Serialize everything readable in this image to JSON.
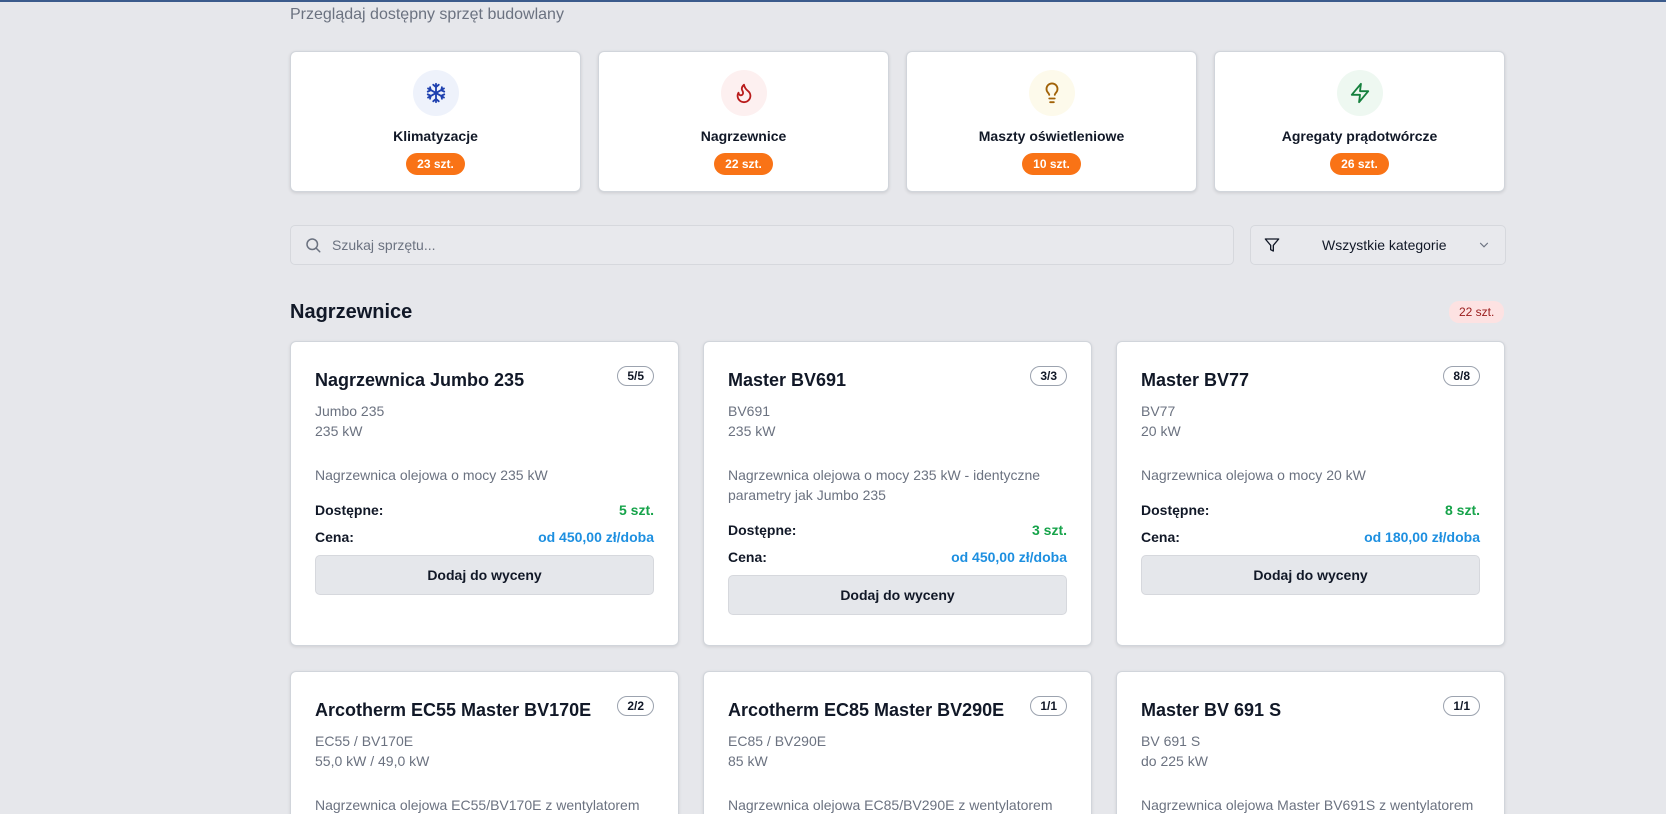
{
  "subtitle": "Przeglądaj dostępny sprzęt budowlany",
  "categories": [
    {
      "name": "Klimatyzacje",
      "count": "23 szt.",
      "icon": "snowflake-icon",
      "icon_bg": "#eef2fb",
      "icon_color": "#1e40af"
    },
    {
      "name": "Nagrzewnice",
      "count": "22 szt.",
      "icon": "flame-icon",
      "icon_bg": "#fdf0f0",
      "icon_color": "#b91c1c"
    },
    {
      "name": "Maszty oświetleniowe",
      "count": "10 szt.",
      "icon": "lightbulb-icon",
      "icon_bg": "#fdfaeb",
      "icon_color": "#a16207"
    },
    {
      "name": "Agregaty prądotwórcze",
      "count": "26 szt.",
      "icon": "lightning-icon",
      "icon_bg": "#eef8f1",
      "icon_color": "#15803d"
    }
  ],
  "search": {
    "placeholder": "Szukaj sprzętu..."
  },
  "filter": {
    "label": "Wszystkie kategorie"
  },
  "section": {
    "title": "Nagrzewnice",
    "count": "22 szt."
  },
  "labels": {
    "available": "Dostępne:",
    "price": "Cena:",
    "add_button": "Dodaj do wyceny"
  },
  "colors": {
    "accent": "#f97316",
    "available": "#16a34a",
    "price": "#1d8fe0"
  },
  "products": [
    {
      "title": "Nagrzewnica Jumbo 235",
      "stock": "5/5",
      "model": "Jumbo 235",
      "power": "235 kW",
      "desc": "Nagrzewnica olejowa o mocy 235 kW",
      "available": "5 szt.",
      "price": "od 450,00 zł/doba"
    },
    {
      "title": "Master BV691",
      "stock": "3/3",
      "model": "BV691",
      "power": "235 kW",
      "desc": "Nagrzewnica olejowa o mocy 235 kW - identyczne parametry jak Jumbo 235",
      "available": "3 szt.",
      "price": "od 450,00 zł/doba"
    },
    {
      "title": "Master BV77",
      "stock": "8/8",
      "model": "BV77",
      "power": "20 kW",
      "desc": "Nagrzewnica olejowa o mocy 20 kW",
      "available": "8 szt.",
      "price": "od 180,00 zł/doba"
    },
    {
      "title": "Arcotherm EC55 Master BV170E",
      "stock": "2/2",
      "model": "EC55 / BV170E",
      "power": "55,0 kW / 49,0 kW",
      "desc": "Nagrzewnica olejowa EC55/BV170E z wentylatorem"
    },
    {
      "title": "Arcotherm EC85 Master BV290E",
      "stock": "1/1",
      "model": "EC85 / BV290E",
      "power": "85 kW",
      "desc": "Nagrzewnica olejowa EC85/BV290E z wentylatorem"
    },
    {
      "title": "Master BV 691 S",
      "stock": "1/1",
      "model": "BV 691 S",
      "power": "do 225 kW",
      "desc": "Nagrzewnica olejowa Master BV691S z wentylatorem"
    }
  ]
}
